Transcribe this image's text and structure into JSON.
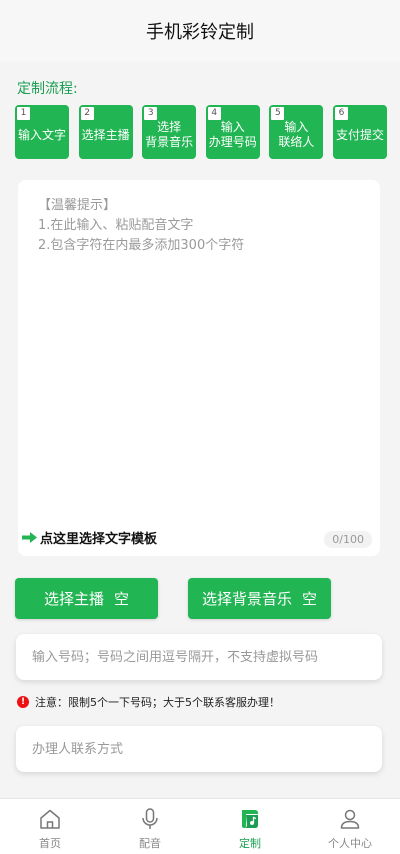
{
  "header": {
    "title": "手机彩铃定制"
  },
  "flow": {
    "label": "定制流程:",
    "steps": [
      {
        "num": "1",
        "label": "输入文字"
      },
      {
        "num": "2",
        "label": "选择主播"
      },
      {
        "num": "3",
        "label": "选择\n背景音乐"
      },
      {
        "num": "4",
        "label": "输入\n办理号码"
      },
      {
        "num": "5",
        "label": "输入\n联络人"
      },
      {
        "num": "6",
        "label": "支付提交"
      }
    ]
  },
  "editor": {
    "tip_title": "【温馨提示】",
    "tip_line1": "1.在此输入、粘贴配音文字",
    "tip_line2": "2.包含字符在内最多添加300个字符",
    "template_link": "点这里选择文字模板",
    "counter": "0/100"
  },
  "buttons": {
    "anchor_label": "选择主播",
    "anchor_value": "空",
    "music_label": "选择背景音乐",
    "music_value": "空"
  },
  "phone": {
    "placeholder": "输入号码；号码之间用逗号隔开，不支持虚拟号码"
  },
  "notice": {
    "icon": "!",
    "text": "注意：限制5个一下号码；大于5个联系客服办理！"
  },
  "contact": {
    "placeholder": "办理人联系方式"
  },
  "tabbar": {
    "items": [
      {
        "label": "首页",
        "icon": "home-icon"
      },
      {
        "label": "配音",
        "icon": "microphone-icon"
      },
      {
        "label": "定制",
        "icon": "custom-music-icon"
      },
      {
        "label": "个人中心",
        "icon": "user-icon"
      }
    ]
  },
  "colors": {
    "accent": "#22b553",
    "warning": "#e11111"
  }
}
